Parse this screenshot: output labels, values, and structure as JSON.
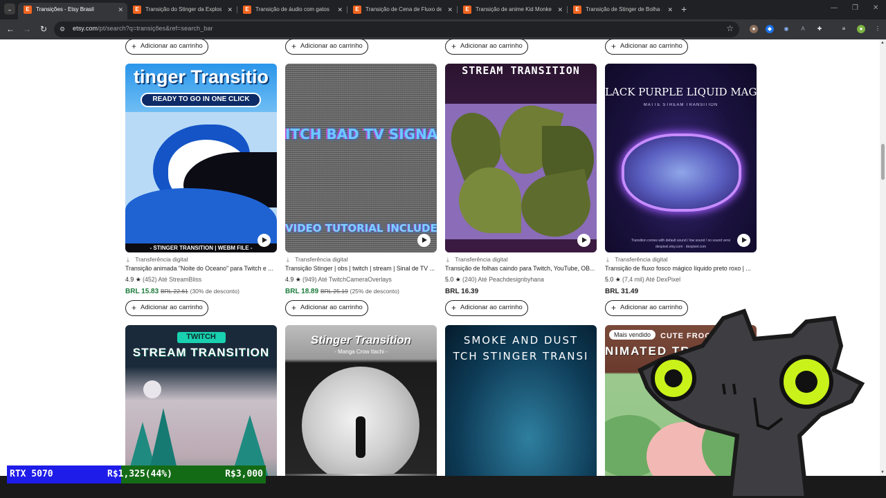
{
  "browser": {
    "tabs": [
      {
        "title": "Transições - Etsy Brasil",
        "active": true
      },
      {
        "title": "Transição do Stinger da Explosã",
        "active": false
      },
      {
        "title": "Transição de áudio com gatos",
        "active": false
      },
      {
        "title": "Transição de Cena de Fluxo de",
        "active": false
      },
      {
        "title": "Transição de anime Kid Monke",
        "active": false
      },
      {
        "title": "Transição de Stinger de Bolha d",
        "active": false
      }
    ],
    "favicon_letter": "E",
    "new_tab_symbol": "+",
    "url_domain": "etsy.com",
    "url_path": "/pt/search?q=transições&ref=search_bar"
  },
  "colors": {
    "etsy_orange": "#f1641e",
    "sale_green": "#1a7a3a",
    "gpu_blue": "#1e1ce8",
    "gpu_green": "#146b16"
  },
  "cart_label": "Adicionar ao carrinho",
  "products": [
    {
      "digital_label": "Transferência digital",
      "title": "Transição animada \"Noite do Oceano\" para Twitch e ...",
      "rating": "4.9",
      "reviews": "(452)",
      "shop": "Até StreamBliss",
      "price": "BRL 15.83",
      "original_price": "BRL 22.61",
      "discount": "(30% de desconto)",
      "art_top": "tinger Transitio",
      "art_sub": "READY TO GO IN ONE CLICK",
      "art_bottom": "- STINGER TRANSITION | WEBM FILE -"
    },
    {
      "digital_label": "Transferência digital",
      "title": "Transição Stinger | obs | twitch | stream | Sinal de TV ...",
      "rating": "4.9",
      "reviews": "(949)",
      "shop": "Até TwitchCameraOverlays",
      "price": "BRL 18.89",
      "original_price": "BRL 25.19",
      "discount": "(25% de desconto)",
      "art_top": "ITCH BAD TV SIGNAL TRANSI",
      "art_bottom": "VIDEO TUTORIAL INCLUDED"
    },
    {
      "digital_label": "Transferência digital",
      "title": "Transição de folhas caindo para Twitch, YouTube, OB...",
      "rating": "5.0",
      "reviews": "(240)",
      "shop": "Até Peachdesignbyhana",
      "price": "BRL 16.39",
      "art_top": "STREAM TRANSITION"
    },
    {
      "digital_label": "Transferência digital",
      "title": "Transição de fluxo fosco mágico líquido preto roxo | ...",
      "rating": "5.0",
      "reviews": "(7,4 mil)",
      "shop": "Até DexPixel",
      "price": "BRL 31.49",
      "art_top": "LACK PURPLE LIQUID MAGI",
      "art_sub": "MATTE STREAM TRANSITION",
      "art_bottom": "Transition comes with default sound / low sound / no sound versi",
      "art_url": "dexpixel.etsy.com · dexpixel.com"
    }
  ],
  "next_row": [
    {
      "art_top": "TWITCH",
      "art_sub": "STREAM TRANSITION"
    },
    {
      "art_top": "Stinger Transition",
      "art_sub": "- Manga Crow Itachi -"
    },
    {
      "art_top": "SMOKE AND DUST",
      "art_sub": "TCH STINGER TRANSI"
    },
    {
      "badge": "Mais vendido",
      "art_top": "CUTE FROG",
      "art_sub": "NIMATED TR"
    }
  ],
  "overlay": {
    "gpu_name": "RTX 5070",
    "progress_text": "R$1,325(44%)",
    "progress_fraction": 0.44,
    "goal_text": "R$3,000"
  }
}
